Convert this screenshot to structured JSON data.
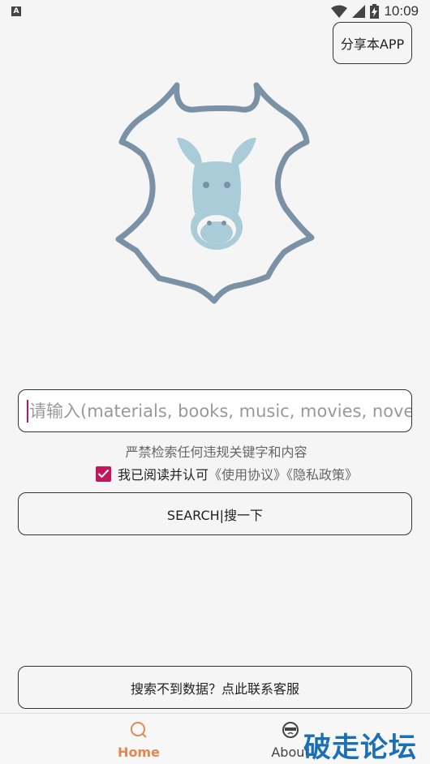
{
  "status_bar": {
    "notification_badge": "A",
    "time": "10:09",
    "icons": [
      "wifi-icon",
      "signal-icon",
      "battery-charging-icon"
    ]
  },
  "share_button": {
    "label": "分享本APP"
  },
  "logo": {
    "icon": "donkey-leather-logo-icon",
    "colors": {
      "outline": "#7a91a6",
      "donkey": "#a9ccd8"
    }
  },
  "search": {
    "value": "",
    "placeholder": "请输入(materials, books, music, movies, novel"
  },
  "notice": {
    "text": "严禁检索任何违规关键字和内容"
  },
  "agreement": {
    "checked": true,
    "label": "我已阅读并认可",
    "terms_link": "《使用协议》",
    "privacy_link": "《隐私政策》"
  },
  "search_button": {
    "label": "SEARCH|搜一下"
  },
  "contact_button": {
    "label": "搜索不到数据？点此联系客服"
  },
  "bottom_nav": {
    "items": [
      {
        "label": "Home",
        "icon": "search-icon",
        "active": true
      },
      {
        "label": "About",
        "icon": "face-icon",
        "active": false
      }
    ]
  },
  "watermark": {
    "text": "破走论坛"
  },
  "colors": {
    "accent": "#c2185b",
    "nav_active": "#e08a52",
    "watermark": "#1a6fb5"
  }
}
